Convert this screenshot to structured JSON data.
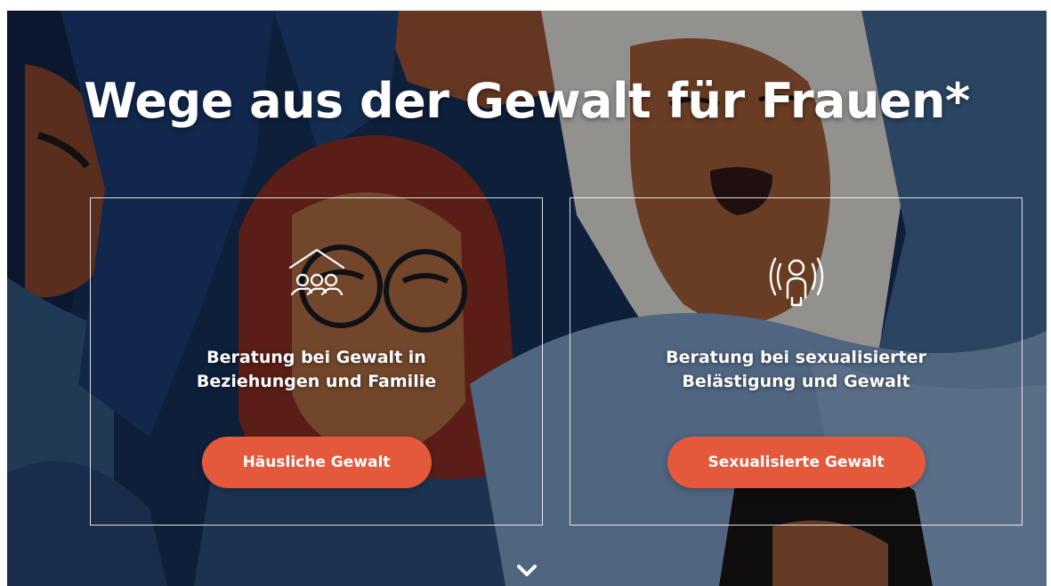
{
  "hero": {
    "title": "Wege aus der Gewalt für Frauen*",
    "cards": [
      {
        "icon": "family-house-icon",
        "text_line1": "Beratung bei Gewalt in",
        "text_line2": "Beziehungen und Familie",
        "button_label": "Häusliche Gewalt"
      },
      {
        "icon": "person-alarm-icon",
        "text_line1": "Beratung bei sexualisierter",
        "text_line2": "Belästigung und Gewalt",
        "button_label": "Sexualisierte Gewalt"
      }
    ],
    "scroll_icon": "chevron-down-icon"
  },
  "colors": {
    "button": "#e4583b",
    "background": "#0f1e33",
    "text": "#ffffff"
  }
}
